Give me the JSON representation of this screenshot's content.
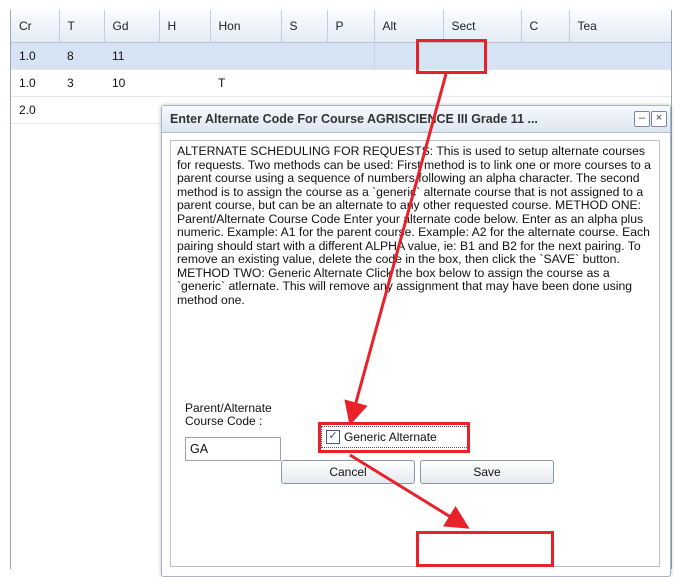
{
  "grid": {
    "columns": [
      "Cr",
      "T",
      "Gd",
      "H",
      "Hon",
      "S",
      "P",
      "Alt",
      "Sect",
      "C",
      "Tea"
    ],
    "rows": [
      [
        "1.0",
        "8",
        "11",
        "",
        "",
        "",
        "",
        "",
        "",
        "",
        ""
      ],
      [
        "1.0",
        "3",
        "10",
        "",
        "T",
        "",
        "",
        "",
        "",
        "",
        ""
      ],
      [
        "2.0",
        "",
        "",
        "",
        "",
        "",
        "",
        "",
        "",
        "",
        ""
      ]
    ]
  },
  "dialog": {
    "title": "Enter Alternate Code For Course AGRISCIENCE III Grade 11 ...",
    "minimize_icon": "minimize-icon",
    "close_icon": "close-icon",
    "description": "ALTERNATE SCHEDULING FOR REQUESTS: This is used to setup alternate courses for requests. Two methods can be used: First method is to link one or more courses to a parent course using a sequence of numbers following an alpha character. The second method is to assign the course as a `generic` alternate course that is not assigned to a parent course, but can be an alternate to any other requested course. METHOD ONE: Parent/Alternate Course Code Enter your alternate code below. Enter as an alpha plus numeric. Example: A1 for the parent course. Example: A2 for the alternate course. Each pairing should start with a different ALPHA value, ie: B1 and B2 for the next pairing. To remove an existing value, delete the code in the box, then click the `SAVE` button. METHOD TWO: Generic Alternate Click the box below to assign the course as a `generic` atlernate. This will remove any assignment that may have been done using method one.",
    "code_label": "Parent/Alternate Course Code :",
    "code_value": "GA",
    "generic_label": "Generic Alternate",
    "generic_checked": "✓",
    "cancel_label": "Cancel",
    "save_label": "Save"
  },
  "annotation_color": "#e8212a"
}
